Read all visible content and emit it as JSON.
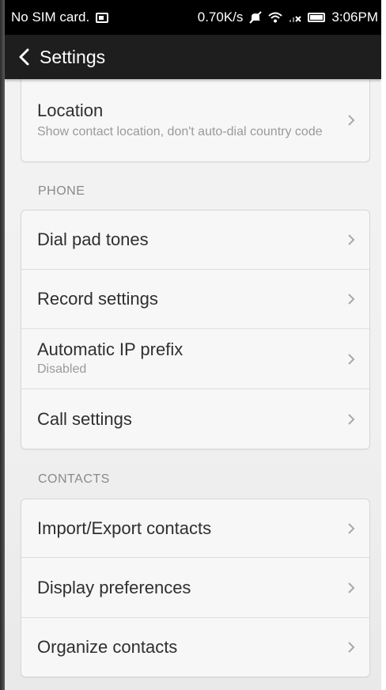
{
  "status_bar": {
    "carrier": "No SIM card.",
    "speed": "0.70K/s",
    "time": "3:06PM"
  },
  "header": {
    "title": "Settings"
  },
  "location": {
    "title": "Location",
    "subtitle": "Show contact location, don't auto-dial country code"
  },
  "sections": {
    "phone": {
      "label": "PHONE",
      "items": [
        {
          "title": "Dial pad tones"
        },
        {
          "title": "Record settings"
        },
        {
          "title": "Automatic IP prefix",
          "subtitle": "Disabled"
        },
        {
          "title": "Call settings"
        }
      ]
    },
    "contacts": {
      "label": "CONTACTS",
      "items": [
        {
          "title": "Import/Export contacts"
        },
        {
          "title": "Display preferences"
        },
        {
          "title": "Organize contacts"
        }
      ]
    }
  },
  "icons": {
    "back": "back-arrow-icon",
    "chevron": "chevron-right-icon",
    "sim": "sim-card-icon",
    "mute": "mute-icon",
    "wifi": "wifi-icon",
    "signal": "signal-icon",
    "battery": "battery-icon"
  },
  "colors": {
    "title_bar": "#1e1e1e",
    "status_bar": "#000000",
    "card_bg": "#f7f7f7",
    "text_primary": "#2f2f2f",
    "text_secondary": "#9a9a9a"
  }
}
